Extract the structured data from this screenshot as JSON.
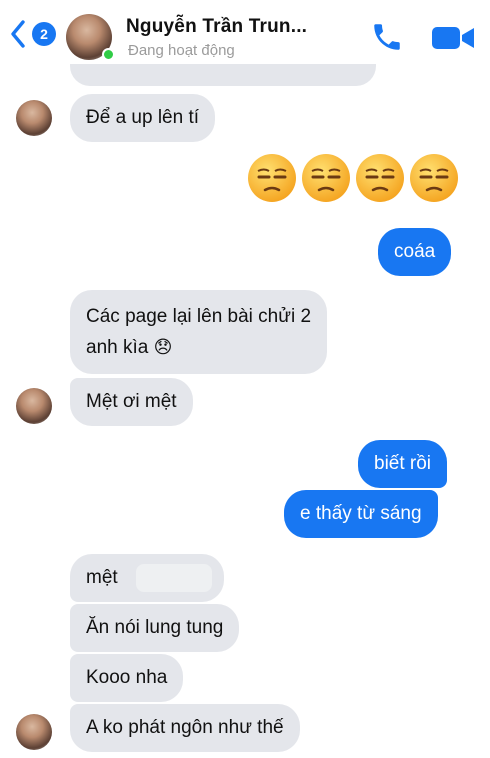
{
  "header": {
    "back_count": "2",
    "title": "Nguyễn Trần Trun...",
    "status": "Đang hoạt động"
  },
  "messages": [
    {
      "side": "in",
      "text": "Để a up lên tí"
    },
    {
      "side": "out",
      "text": "😒😒😒😒"
    },
    {
      "side": "out",
      "text": "coáa"
    },
    {
      "side": "in",
      "line1": "Các page lại lên bài chửi 2",
      "line2": "anh kìa",
      "emoji": "😞"
    },
    {
      "side": "in",
      "text": "Mệt ơi mệt"
    },
    {
      "side": "out",
      "text": "biết rồi"
    },
    {
      "side": "out",
      "text": "e thấy từ sáng"
    },
    {
      "side": "in",
      "text": "mệt"
    },
    {
      "side": "in",
      "text": "Ăn nói lung tung"
    },
    {
      "side": "in",
      "text": "Kooo nha"
    },
    {
      "side": "in",
      "text": "A ko phát ngôn như thế"
    }
  ],
  "colors": {
    "accent": "#1877f2",
    "incoming_bubble": "#e4e6eb",
    "online": "#31cc46"
  },
  "icons": [
    "back-chevron-icon",
    "phone-icon",
    "video-camera-icon",
    "unamused-face-emoji",
    "disappointed-face-emoji"
  ]
}
